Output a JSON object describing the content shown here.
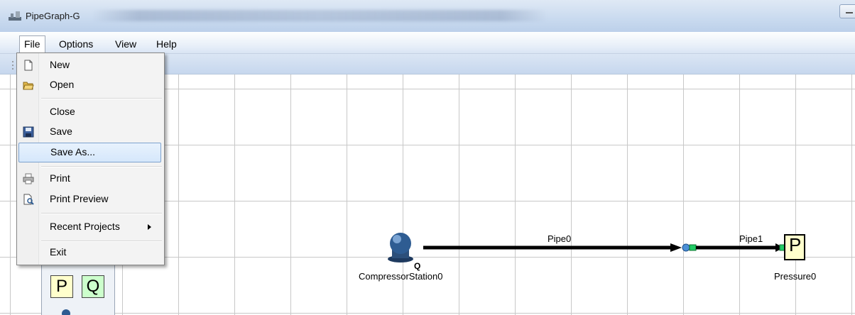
{
  "window": {
    "title": "PipeGraph-G"
  },
  "menubar": {
    "items": [
      {
        "label": "File"
      },
      {
        "label": "Options"
      },
      {
        "label": "View"
      },
      {
        "label": "Help"
      }
    ]
  },
  "file_menu": {
    "new": "New",
    "open": "Open",
    "close": "Close",
    "save": "Save",
    "save_as": "Save As...",
    "print": "Print",
    "print_preview": "Print Preview",
    "recent_projects": "Recent Projects",
    "exit": "Exit"
  },
  "palette": {
    "pressure_label": "P",
    "flow_label": "Q"
  },
  "diagram": {
    "compressor": {
      "label": "CompressorStation0",
      "badge": "Q"
    },
    "pipe0": {
      "label": "Pipe0"
    },
    "pipe1": {
      "label": "Pipe1"
    },
    "pressure": {
      "label": "Pressure0",
      "symbol": "P"
    }
  },
  "colors": {
    "selection": "#d5e7fb",
    "pressure_fill": "#ffffcc",
    "flow_fill": "#ccffcc",
    "node_green": "#22cc66",
    "node_blue": "#4a8fd6"
  },
  "icons": {
    "app": "pipe-app-icon",
    "new": "new-document-icon",
    "open": "open-folder-icon",
    "save": "floppy-disk-icon",
    "print": "printer-icon",
    "print_preview": "print-preview-icon",
    "compressor": "compressor-station-icon"
  }
}
